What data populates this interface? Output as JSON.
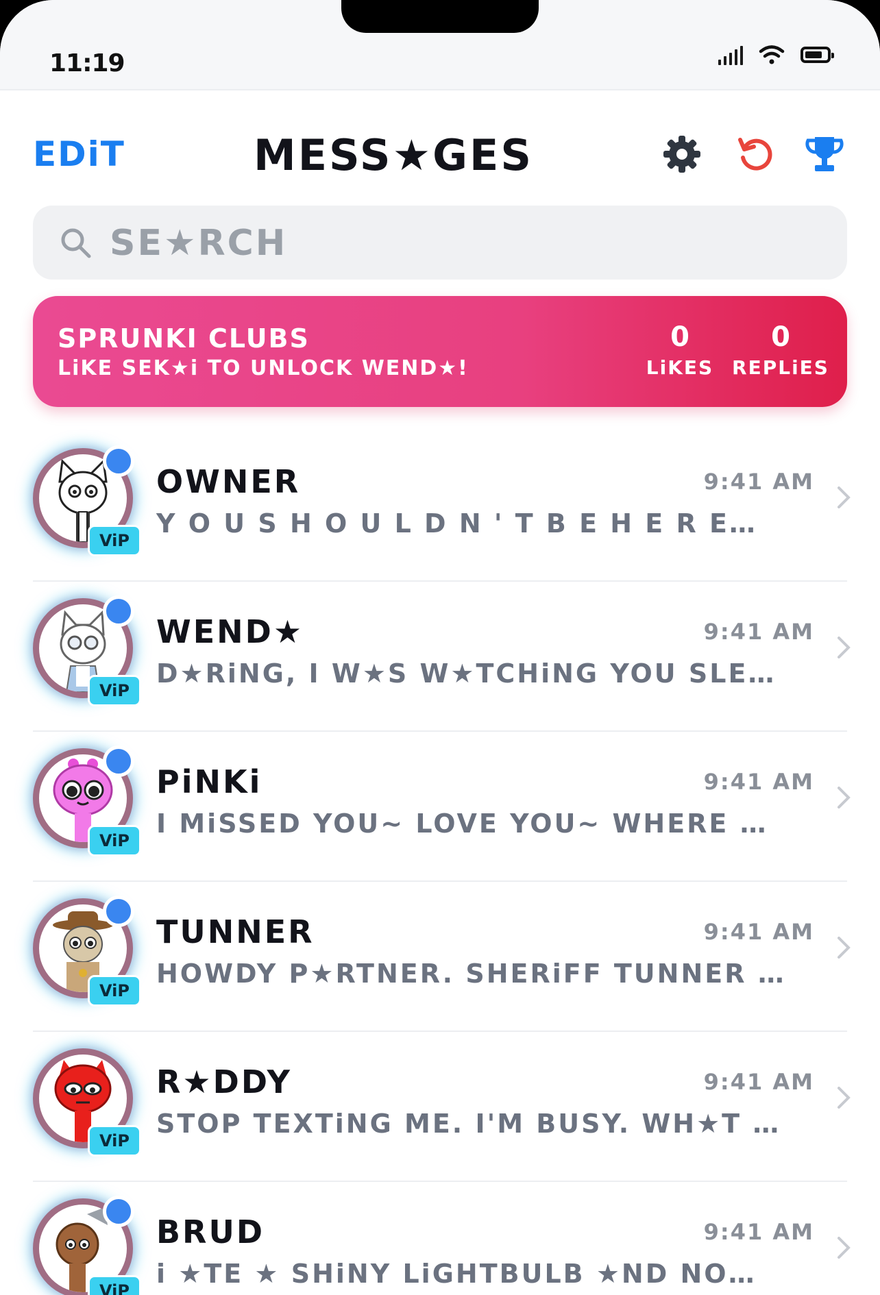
{
  "status_bar": {
    "time": "11:19"
  },
  "header": {
    "edit_label": "EDiT",
    "title": "MESS★GES"
  },
  "search": {
    "placeholder": "SE★RCH"
  },
  "banner": {
    "title": "SPRUNKI CLUBS",
    "subtitle": "LiKE SEK★i TO UNLOCK WEND★!",
    "likes_count": "0",
    "likes_label": "LiKES",
    "replies_count": "0",
    "replies_label": "REPLiES"
  },
  "badge_label": "ViP",
  "colors": {
    "accent": "#1a7ef0",
    "refresh": "#e8453c",
    "banner_start": "#ea4a92",
    "banner_end": "#df1f4b",
    "online_dot": "#3a86f0",
    "vip": "#3ad0f0"
  },
  "conversations": [
    {
      "name": "OWNER",
      "preview": "Y O U S H O U L D N ' T B E H E R E…",
      "time": "9:41 AM",
      "avatar": "white-cat-character"
    },
    {
      "name": "WEND★",
      "preview": "D★RiNG, I W★S W★TCHiNG YOU SLE…",
      "time": "9:41 AM",
      "avatar": "white-cat-glasses-character"
    },
    {
      "name": "PiNKi",
      "preview": "I MiSSED YOU~ LOVE YOU~ WHERE …",
      "time": "9:41 AM",
      "avatar": "pink-character"
    },
    {
      "name": "TUNNER",
      "preview": "HOWDY P★RTNER. SHERiFF TUNNER …",
      "time": "9:41 AM",
      "avatar": "cowboy-character"
    },
    {
      "name": "R★DDY",
      "preview": "STOP TEXTiNG ME. I'M BUSY. WH★T …",
      "time": "9:41 AM",
      "avatar": "red-character"
    },
    {
      "name": "BRUD",
      "preview": "i ★TE ★ SHiNY LiGHTBULB ★ND NO…",
      "time": "9:41 AM",
      "avatar": "brown-character"
    }
  ]
}
